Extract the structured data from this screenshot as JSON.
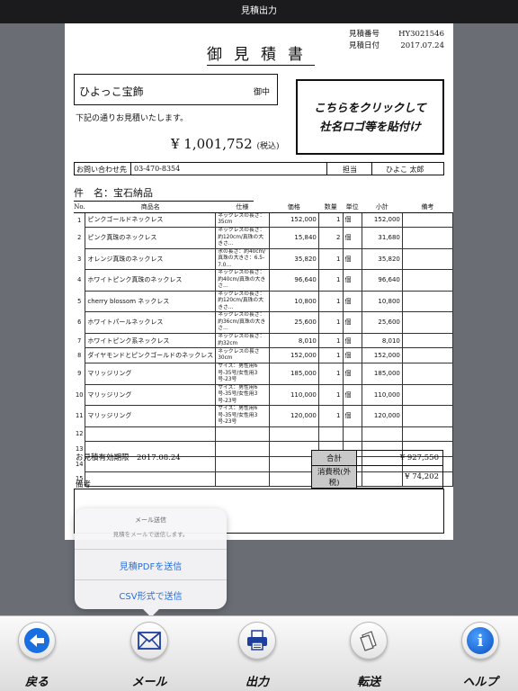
{
  "window": {
    "title": "見積出力"
  },
  "document": {
    "meta": [
      {
        "label": "見積番号",
        "value": "HY3021546"
      },
      {
        "label": "見積日付",
        "value": "2017.07.24"
      }
    ],
    "title": "御見積書",
    "client_name": "ひよっこ宝飾",
    "honorific": "御中",
    "greeting": "下記の通りお見積いたします。",
    "total_amount": "¥ 1,001,752",
    "tax_note": "(税込)",
    "logo_text_line1": "こちらをクリックして",
    "logo_text_line2": "社名ロゴ等を貼付け",
    "contact_label": "お問い合わせ先",
    "contact_phone": "03-470-8354",
    "person_label": "担当",
    "person_name": "ひよこ 太郎",
    "subject": "件　名：宝石納品",
    "columns": [
      "No.",
      "商品名",
      "仕様",
      "価格",
      "数量",
      "単位",
      "小計",
      "備考"
    ],
    "rows": [
      {
        "no": "1",
        "name": "ピンクゴールドネックレス",
        "spec": "ネックレスの長さ：35cm",
        "price": "152,000",
        "qty": "1",
        "unit": "個",
        "subtotal": "152,000",
        "note": ""
      },
      {
        "no": "2",
        "name": "ピンク真珠のネックレス",
        "spec": "ネックレスの長さ：約120cm/真珠の大きさ…",
        "price": "15,840",
        "qty": "2",
        "unit": "個",
        "subtotal": "31,680",
        "note": ""
      },
      {
        "no": "3",
        "name": "オレンジ真珠のネックレス",
        "spec": "氷の長さ：約40cm/真珠の大きさ：6.5-7.0…",
        "price": "35,820",
        "qty": "1",
        "unit": "個",
        "subtotal": "35,820",
        "note": ""
      },
      {
        "no": "4",
        "name": "ホワイトピンク真珠のネックレス",
        "spec": "ネックレスの長さ：約40cm/真珠の大きさ…",
        "price": "96,640",
        "qty": "1",
        "unit": "個",
        "subtotal": "96,640",
        "note": ""
      },
      {
        "no": "5",
        "name": "cherry blossom ネックレス",
        "spec": "ネックレスの長さ：約120cm/真珠の大きさ…",
        "price": "10,800",
        "qty": "1",
        "unit": "個",
        "subtotal": "10,800",
        "note": ""
      },
      {
        "no": "6",
        "name": "ホワイトパールネックレス",
        "spec": "ネックレスの長さ：約36cm/真珠の大きさ…",
        "price": "25,600",
        "qty": "1",
        "unit": "個",
        "subtotal": "25,600",
        "note": ""
      },
      {
        "no": "7",
        "name": "ホワイトピンク系ネックレス",
        "spec": "ネックレスの長さ：約32cm",
        "price": "8,010",
        "qty": "1",
        "unit": "個",
        "subtotal": "8,010",
        "note": ""
      },
      {
        "no": "8",
        "name": "ダイヤモンドとピンクゴールドのネックレス",
        "spec": "ネックレスの長さ30cm",
        "price": "152,000",
        "qty": "1",
        "unit": "個",
        "subtotal": "152,000",
        "note": ""
      },
      {
        "no": "9",
        "name": "マリッジリング",
        "spec": "サイズ：男性用6号-35号/女性用3号-23号",
        "price": "185,000",
        "qty": "1",
        "unit": "個",
        "subtotal": "185,000",
        "note": ""
      },
      {
        "no": "10",
        "name": "マリッジリング",
        "spec": "サイズ：男性用6号-35号/女性用3号-23号",
        "price": "110,000",
        "qty": "1",
        "unit": "個",
        "subtotal": "110,000",
        "note": ""
      },
      {
        "no": "11",
        "name": "マリッジリング",
        "spec": "サイズ：男性用6号-35号/女性用3号-23号",
        "price": "120,000",
        "qty": "1",
        "unit": "個",
        "subtotal": "120,000",
        "note": ""
      },
      {
        "no": "12",
        "name": "",
        "spec": "",
        "price": "",
        "qty": "",
        "unit": "",
        "subtotal": "",
        "note": ""
      },
      {
        "no": "13",
        "name": "",
        "spec": "",
        "price": "",
        "qty": "",
        "unit": "",
        "subtotal": "",
        "note": ""
      },
      {
        "no": "14",
        "name": "",
        "spec": "",
        "price": "",
        "qty": "",
        "unit": "",
        "subtotal": "",
        "note": ""
      },
      {
        "no": "15",
        "name": "",
        "spec": "",
        "price": "",
        "qty": "",
        "unit": "",
        "subtotal": "",
        "note": ""
      }
    ],
    "validity": "お見積有効期限　2017.08.24",
    "sum_label": "合計",
    "sum_value": "¥ 927,550",
    "tax_label": "消費税(外税)",
    "tax_value": "¥ 74,202",
    "remarks_label": "備考"
  },
  "popover": {
    "title": "メール送信",
    "message": "見積をメールで送信します。",
    "option_pdf": "見積PDFを送信",
    "option_csv": "CSV形式で送信"
  },
  "toolbar": {
    "back": "戻る",
    "mail": "メール",
    "output": "出力",
    "forward": "転送",
    "help": "ヘルプ"
  },
  "colors": {
    "accent_blue": "#2a6fd6",
    "window_bg": "#6b6d75",
    "titlebar_bg": "#1b1b1d"
  }
}
